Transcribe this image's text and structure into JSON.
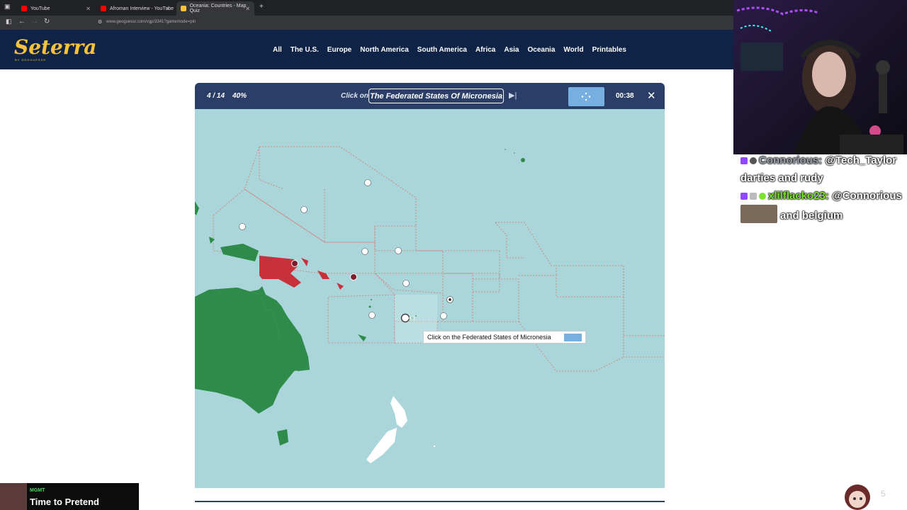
{
  "browser": {
    "tabs": [
      {
        "title": "YouTube",
        "active": false,
        "favicon_color": "#ff0000"
      },
      {
        "title": "Afroman Interview - YouTube",
        "active": false,
        "favicon_color": "#ff0000"
      },
      {
        "title": "Oceania: Countries - Map Quiz",
        "active": true,
        "favicon_color": "#f8c33b"
      }
    ],
    "url": "www.geoguessr.com/vgp/3341?gamemode=pin"
  },
  "site": {
    "logo": "Seterra",
    "logo_sub": "BY GEOGUESSR",
    "nav": [
      "All",
      "The U.S.",
      "Europe",
      "North America",
      "South America",
      "Africa",
      "Asia",
      "Oceania",
      "World",
      "Printables"
    ]
  },
  "game": {
    "progress": "4 / 14",
    "percent": "40%",
    "click_on_label": "Click on",
    "target": "The Federated States Of Micronesia",
    "timer": "00:38",
    "tooltip": "Click on the Federated States of Micronesia",
    "colors": {
      "sea": "#aad6db",
      "correct": "#2e8b4a",
      "wrong": "#c8303c",
      "land_neutral": "#ffffff",
      "bar": "#2a3e67",
      "flag": "#77b0e0"
    }
  },
  "chat": {
    "messages": [
      {
        "user": "Connorious:",
        "mention": "@Tech_Taylor",
        "text": "darties and rudy"
      },
      {
        "user": "xlilflacko23:",
        "mention": "@Connorious",
        "text": "and belgium"
      }
    ]
  },
  "now_playing": {
    "artist": "MGMT",
    "title": "Time to Pretend"
  },
  "viewer_count": "5"
}
